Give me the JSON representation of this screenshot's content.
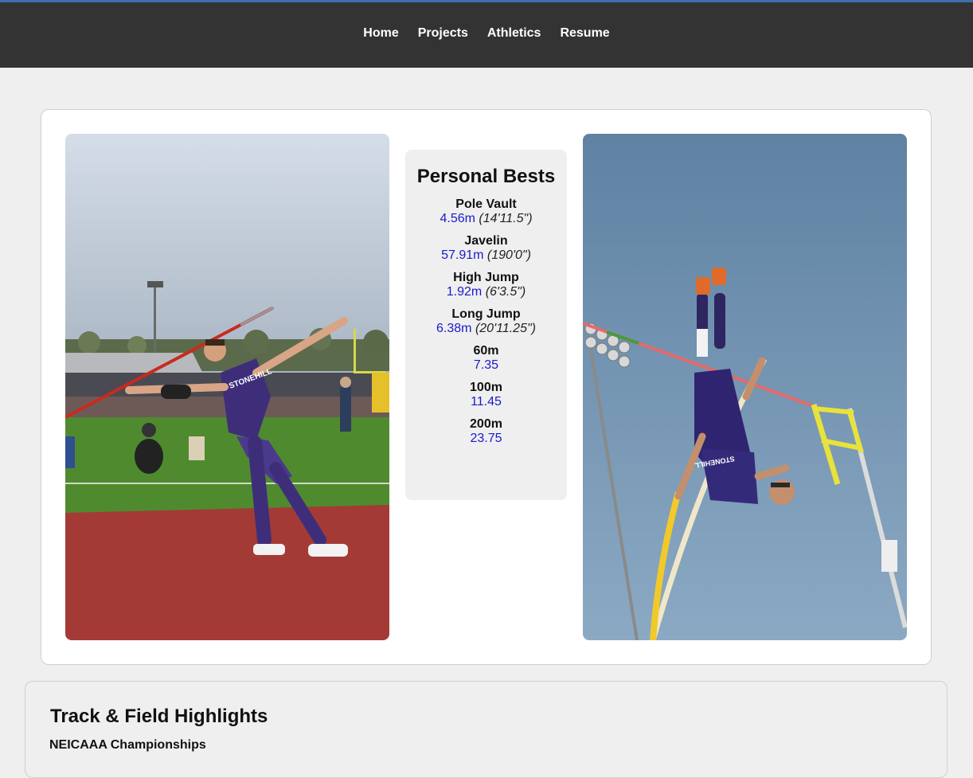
{
  "nav": {
    "items": [
      {
        "label": "Home"
      },
      {
        "label": "Projects"
      },
      {
        "label": "Athletics"
      },
      {
        "label": "Resume"
      }
    ]
  },
  "personal_bests": {
    "title": "Personal Bests",
    "events": [
      {
        "name": "Pole Vault",
        "metric": "4.56m",
        "imperial": "(14'11.5\")"
      },
      {
        "name": "Javelin",
        "metric": "57.91m",
        "imperial": "(190'0\")"
      },
      {
        "name": "High Jump",
        "metric": "1.92m",
        "imperial": "(6'3.5\")"
      },
      {
        "name": "Long Jump",
        "metric": "6.38m",
        "imperial": "(20'11.25\")"
      },
      {
        "name": "60m",
        "metric": "7.35",
        "imperial": ""
      },
      {
        "name": "100m",
        "metric": "11.45",
        "imperial": ""
      },
      {
        "name": "200m",
        "metric": "23.75",
        "imperial": ""
      }
    ]
  },
  "photos": {
    "left": {
      "jersey": "STONEHILL"
    },
    "right": {
      "jersey": "STONEHILL"
    }
  },
  "highlights": {
    "title": "Track & Field Highlights",
    "subtitle": "NEICAAA Championships"
  },
  "colors": {
    "navbar": "#333333",
    "accent_link": "#1a1acc",
    "page_bg": "#efefef"
  }
}
